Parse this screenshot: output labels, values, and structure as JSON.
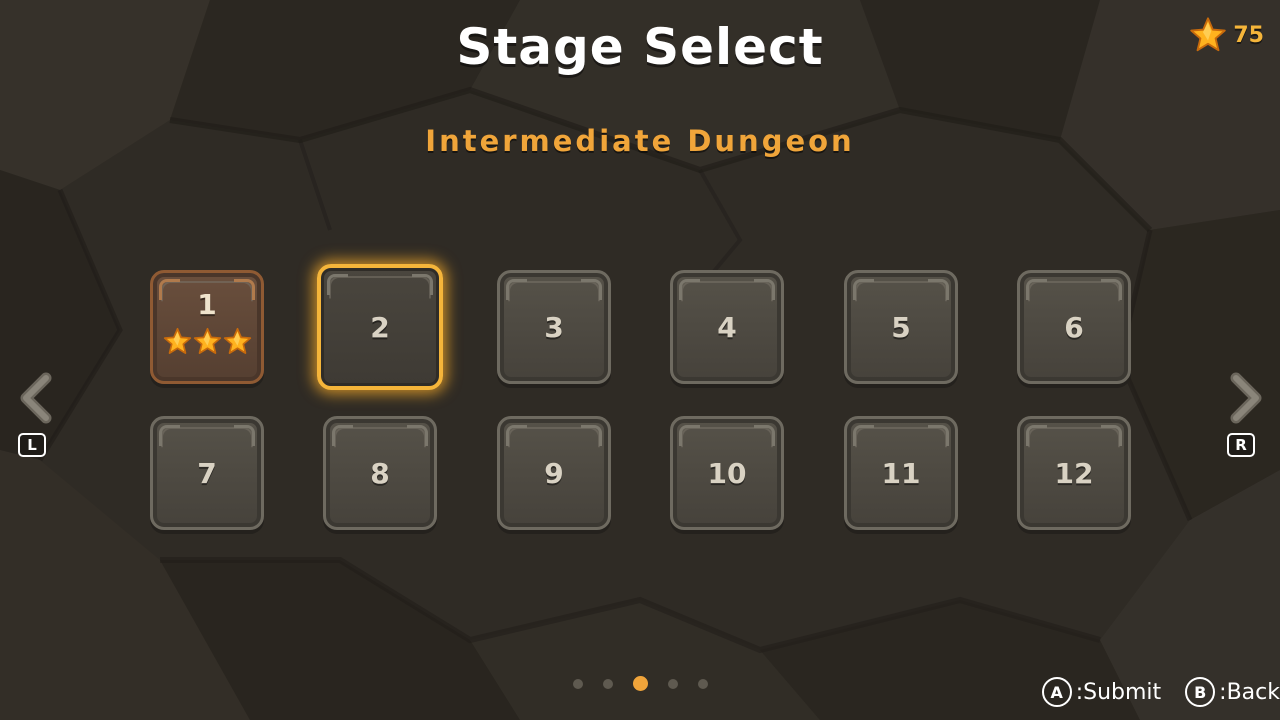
{
  "colors": {
    "accent": "#f5b53a",
    "subtitle": "#f0a53a",
    "background": "#2e2a24"
  },
  "header": {
    "title": "Stage Select",
    "subtitle": "Intermediate Dungeon"
  },
  "currency": {
    "icon": "star-icon",
    "count": "75"
  },
  "stages": [
    {
      "number": "1",
      "state": "cleared",
      "stars": 3
    },
    {
      "number": "2",
      "state": "selected"
    },
    {
      "number": "3",
      "state": "locked"
    },
    {
      "number": "4",
      "state": "locked"
    },
    {
      "number": "5",
      "state": "locked"
    },
    {
      "number": "6",
      "state": "locked"
    },
    {
      "number": "7",
      "state": "locked"
    },
    {
      "number": "8",
      "state": "locked"
    },
    {
      "number": "9",
      "state": "locked"
    },
    {
      "number": "10",
      "state": "locked"
    },
    {
      "number": "11",
      "state": "locked"
    },
    {
      "number": "12",
      "state": "locked"
    }
  ],
  "navigation": {
    "left_arrow_icon": "chevron-left-icon",
    "right_arrow_icon": "chevron-right-icon",
    "left_button": "L",
    "right_button": "R"
  },
  "pagination": {
    "total_pages": 5,
    "current_page": 3
  },
  "hints": {
    "submit_button": "A",
    "submit_label": ":Submit",
    "back_button": "B",
    "back_label": ":Back"
  }
}
